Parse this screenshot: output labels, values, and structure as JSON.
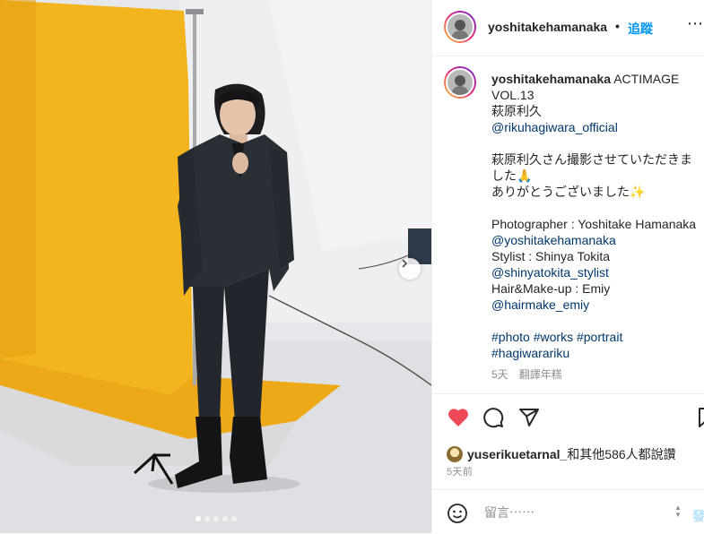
{
  "post": {
    "username": "yoshitakehamanaka",
    "separator": "•",
    "follow_label": "追蹤",
    "more_label": "⋯",
    "caption": {
      "username": "yoshitakehamanaka",
      "line1": " ACTIMAGE VOL.13",
      "line2": "萩原利久",
      "mention1": "@rikuhagiwara_official",
      "line3": "萩原利久さん撮影させていただきました🙏",
      "line4": "ありがとうございました✨",
      "credit_photo": "Photographer : Yoshitake Hamanaka ",
      "mention_photo": "@yoshitakehamanaka",
      "credit_stylist": "Stylist : Shinya Tokita",
      "mention_stylist": "@shinyatokita_stylist",
      "credit_hair": "Hair&Make-up : Emiy",
      "mention_hair": "@hairmake_emiy",
      "hashtags": [
        "#photo",
        "#works",
        "#portrait",
        "#hagiwarariku"
      ]
    },
    "caption_age": "5天",
    "see_translation": "翻譯年糕",
    "likes": {
      "liker": "yuserikuetarnal_",
      "rest": "和其他586人都說讚"
    },
    "posted_ago": "5天前",
    "comment_placeholder": "留言⋯⋯",
    "post_label": "發",
    "carousel": {
      "total": 5,
      "active_index": 0
    }
  },
  "colors": {
    "like_red": "#ed4956",
    "link_blue": "#0095f6",
    "tag_navy": "#00376b",
    "backdrop_yellow": "#f2b51d"
  },
  "icons": [
    "heart-icon",
    "comment-icon",
    "share-icon",
    "save-icon",
    "emoji-icon",
    "chevron-right-icon"
  ]
}
